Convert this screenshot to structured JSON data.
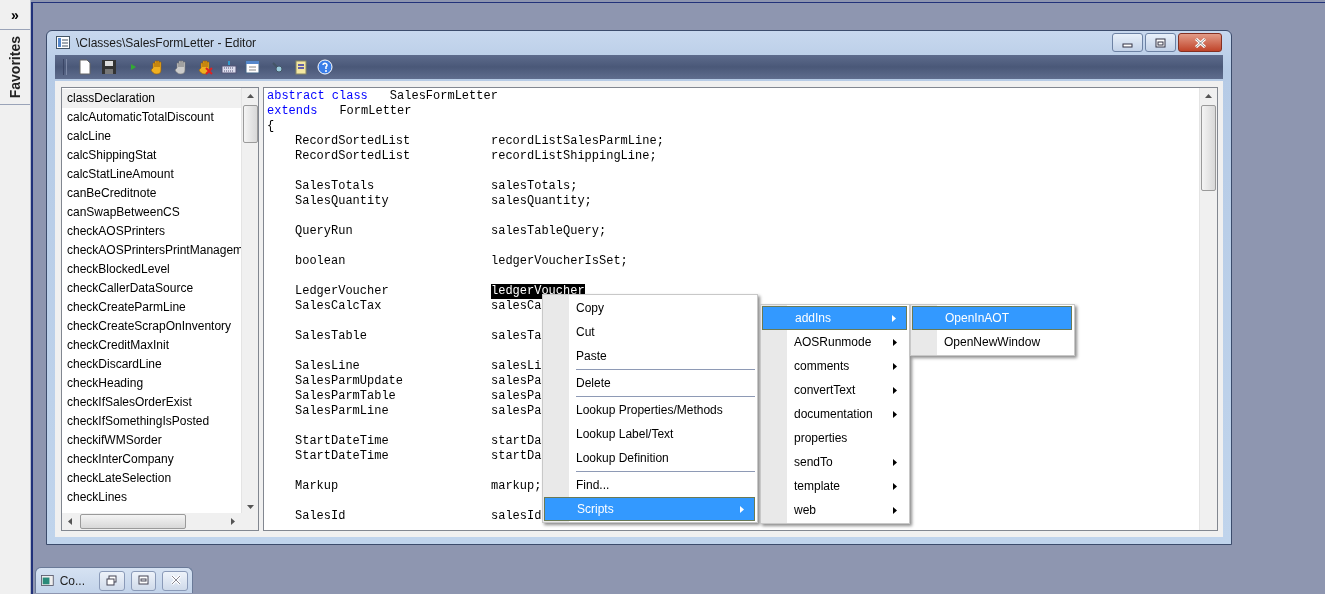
{
  "sidebar": {
    "toggle": "»",
    "title": "Favorites"
  },
  "editor": {
    "title": "\\Classes\\SalesFormLetter - Editor",
    "methods": [
      {
        "label": "classDeclaration",
        "selected": true
      },
      {
        "label": "calcAutomaticTotalDiscount",
        "selected": false
      },
      {
        "label": "calcLine",
        "selected": false
      },
      {
        "label": "calcShippingStat",
        "selected": false
      },
      {
        "label": "calcStatLineAmount",
        "selected": false
      },
      {
        "label": "canBeCreditnote",
        "selected": false
      },
      {
        "label": "canSwapBetweenCS",
        "selected": false
      },
      {
        "label": "checkAOSPrinters",
        "selected": false
      },
      {
        "label": "checkAOSPrintersPrintManagem",
        "selected": false
      },
      {
        "label": "checkBlockedLevel",
        "selected": false
      },
      {
        "label": "checkCallerDataSource",
        "selected": false
      },
      {
        "label": "checkCreateParmLine",
        "selected": false
      },
      {
        "label": "checkCreateScrapOnInventory",
        "selected": false
      },
      {
        "label": "checkCreditMaxInit",
        "selected": false
      },
      {
        "label": "checkDiscardLine",
        "selected": false
      },
      {
        "label": "checkHeading",
        "selected": false
      },
      {
        "label": "checkIfSalesOrderExist",
        "selected": false
      },
      {
        "label": "checkIfSomethingIsPosted",
        "selected": false
      },
      {
        "label": "checkifWMSorder",
        "selected": false
      },
      {
        "label": "checkInterCompany",
        "selected": false
      },
      {
        "label": "checkLateSelection",
        "selected": false
      },
      {
        "label": "checkLines",
        "selected": false
      }
    ],
    "code_lines": [
      {
        "kind": "keyword",
        "keyword": "abstract class",
        "name": "SalesFormLetter"
      },
      {
        "kind": "keyword",
        "keyword": "extends",
        "name": "FormLetter"
      },
      {
        "kind": "plain",
        "text": "{"
      },
      {
        "kind": "decl",
        "type": "RecordSortedList",
        "name": "recordListSalesParmLine;",
        "selected": false
      },
      {
        "kind": "decl",
        "type": "RecordSortedList",
        "name": "recordListShippingLine;",
        "selected": false
      },
      {
        "kind": "blank"
      },
      {
        "kind": "decl",
        "type": "SalesTotals",
        "name": "salesTotals;",
        "selected": false
      },
      {
        "kind": "decl",
        "type": "SalesQuantity",
        "name": "salesQuantity;",
        "selected": false
      },
      {
        "kind": "blank"
      },
      {
        "kind": "decl",
        "type": "QueryRun",
        "name": "salesTableQuery;",
        "selected": false
      },
      {
        "kind": "blank"
      },
      {
        "kind": "decl",
        "type": "boolean",
        "name": "ledgerVoucherIsSet;",
        "selected": false
      },
      {
        "kind": "blank"
      },
      {
        "kind": "decl",
        "type": "LedgerVoucher",
        "name": "ledgerVoucher",
        "selected": true
      },
      {
        "kind": "decl",
        "type": "SalesCalcTax",
        "name": "salesCa",
        "selected": false
      },
      {
        "kind": "blank"
      },
      {
        "kind": "decl",
        "type": "SalesTable",
        "name": "salesTa",
        "selected": false
      },
      {
        "kind": "blank"
      },
      {
        "kind": "decl",
        "type": "SalesLine",
        "name": "salesLi",
        "selected": false
      },
      {
        "kind": "decl",
        "type": "SalesParmUpdate",
        "name": "salesPa",
        "selected": false
      },
      {
        "kind": "decl",
        "type": "SalesParmTable",
        "name": "salesPa",
        "selected": false
      },
      {
        "kind": "decl",
        "type": "SalesParmLine",
        "name": "salesPa",
        "selected": false
      },
      {
        "kind": "blank"
      },
      {
        "kind": "decl",
        "type": "StartDateTime",
        "name": "startDa",
        "selected": false
      },
      {
        "kind": "decl",
        "type": "StartDateTime",
        "name": "startDa",
        "selected": false
      },
      {
        "kind": "blank"
      },
      {
        "kind": "decl",
        "type": "Markup",
        "name": "markup;",
        "selected": false
      },
      {
        "kind": "blank"
      },
      {
        "kind": "decl",
        "type": "SalesId",
        "name": "salesId",
        "selected": false
      }
    ]
  },
  "context_menu": {
    "items": [
      {
        "kind": "item",
        "label": "Copy",
        "selected": false,
        "submenu": false
      },
      {
        "kind": "item",
        "label": "Cut",
        "selected": false,
        "submenu": false
      },
      {
        "kind": "item",
        "label": "Paste",
        "selected": false,
        "submenu": false
      },
      {
        "kind": "separator"
      },
      {
        "kind": "item",
        "label": "Delete",
        "selected": false,
        "submenu": false
      },
      {
        "kind": "separator"
      },
      {
        "kind": "item",
        "label": "Lookup Properties/Methods",
        "selected": false,
        "submenu": false
      },
      {
        "kind": "item",
        "label": "Lookup Label/Text",
        "selected": false,
        "submenu": false
      },
      {
        "kind": "item",
        "label": "Lookup Definition",
        "selected": false,
        "submenu": false
      },
      {
        "kind": "separator"
      },
      {
        "kind": "item",
        "label": "Find...",
        "selected": false,
        "submenu": false
      },
      {
        "kind": "item",
        "label": "Scripts",
        "selected": true,
        "submenu": true
      }
    ]
  },
  "scripts_submenu": {
    "items": [
      {
        "kind": "item",
        "label": "addIns",
        "selected": true,
        "submenu": true
      },
      {
        "kind": "item",
        "label": "AOSRunmode",
        "selected": false,
        "submenu": true
      },
      {
        "kind": "item",
        "label": "comments",
        "selected": false,
        "submenu": true
      },
      {
        "kind": "item",
        "label": "convertText",
        "selected": false,
        "submenu": true
      },
      {
        "kind": "item",
        "label": "documentation",
        "selected": false,
        "submenu": true
      },
      {
        "kind": "item",
        "label": "properties",
        "selected": false,
        "submenu": false
      },
      {
        "kind": "item",
        "label": "sendTo",
        "selected": false,
        "submenu": true
      },
      {
        "kind": "item",
        "label": "template",
        "selected": false,
        "submenu": true
      },
      {
        "kind": "item",
        "label": "web",
        "selected": false,
        "submenu": true
      }
    ]
  },
  "addins_submenu": {
    "items": [
      {
        "kind": "item",
        "label": "OpenInAOT",
        "selected": true,
        "submenu": false
      },
      {
        "kind": "item",
        "label": "OpenNewWindow",
        "selected": false,
        "submenu": false
      }
    ]
  },
  "minimized_window": {
    "title": "Co..."
  }
}
